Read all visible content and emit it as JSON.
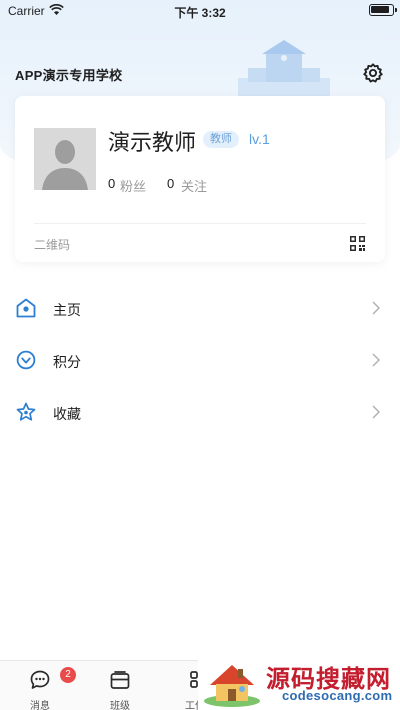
{
  "status_bar": {
    "carrier": "Carrier",
    "time": "下午 3:32"
  },
  "header": {
    "school_name": "APP演示专用学校"
  },
  "profile": {
    "name": "演示教师",
    "role": "教师",
    "level": "lv.1",
    "fans_count": "0",
    "fans_label": "粉丝",
    "follow_count": "0",
    "follow_label": "关注",
    "qr_label": "二维码"
  },
  "menu": [
    {
      "label": "主页",
      "icon": "home-icon"
    },
    {
      "label": "积分",
      "icon": "points-icon"
    },
    {
      "label": "收藏",
      "icon": "star-icon"
    }
  ],
  "tabs": [
    {
      "label": "消息",
      "icon": "message-icon",
      "badge": "2"
    },
    {
      "label": "班级",
      "icon": "class-icon"
    },
    {
      "label": "工作",
      "icon": "work-icon"
    }
  ],
  "watermark": {
    "title": "源码搜藏网",
    "url": "codesocang.com"
  },
  "colors": {
    "accent": "#2d7fd3",
    "badge_red": "#e94b4b",
    "level_blue": "#5b9fe0"
  }
}
